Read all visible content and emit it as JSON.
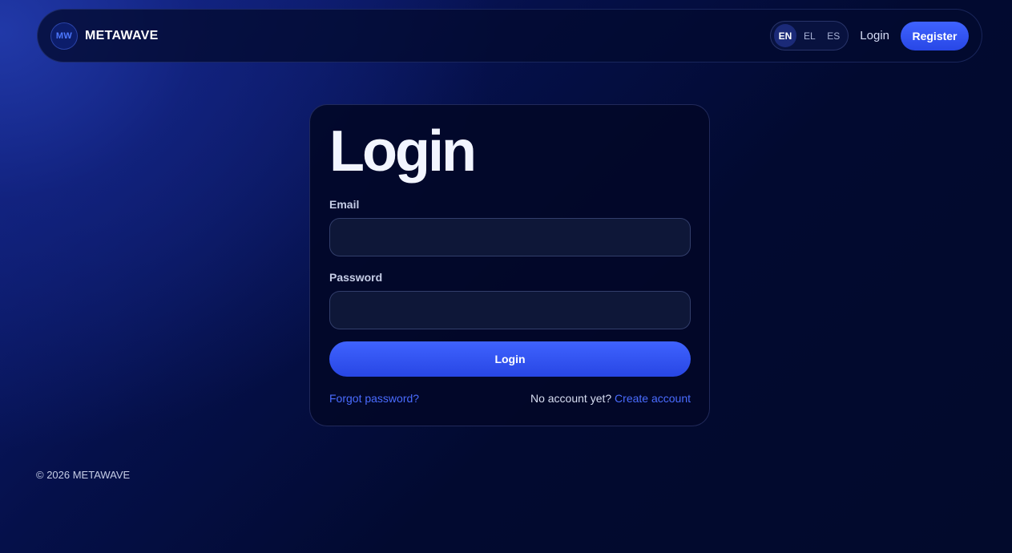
{
  "header": {
    "logo_text": "MW",
    "brand": "METAWAVE",
    "languages": [
      {
        "code": "EN",
        "active": true
      },
      {
        "code": "EL",
        "active": false
      },
      {
        "code": "ES",
        "active": false
      }
    ],
    "login_label": "Login",
    "register_label": "Register"
  },
  "form": {
    "title": "Login",
    "email_label": "Email",
    "email_value": "",
    "password_label": "Password",
    "password_value": "",
    "submit_label": "Login",
    "forgot_label": "Forgot password?",
    "no_account_text": "No account yet?",
    "create_account_label": "Create account"
  },
  "footer": {
    "copyright": "© 2026 METAWAVE"
  },
  "colors": {
    "accent": "#3f63ff",
    "background": "#02082a",
    "link": "#4a6cff"
  }
}
